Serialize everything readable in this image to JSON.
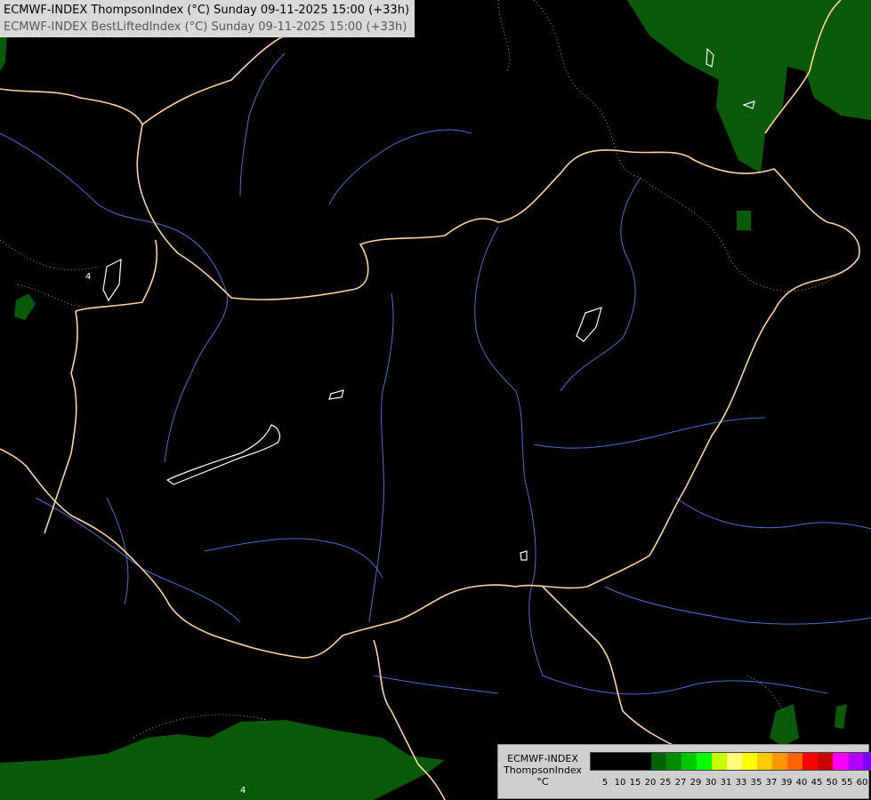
{
  "header": {
    "line1": "ECMWF-INDEX ThompsonIndex (°C) Sunday 09-11-2025 15:00 (+33h)",
    "line2": "ECMWF-INDEX BestLiftedIndex (°C) Sunday 09-11-2025 15:00 (+33h)"
  },
  "map": {
    "background": "#000000",
    "region_fill": "#0a5a0a",
    "border_color": "#ffd39b",
    "river_color": "#4a6fd1",
    "lake_color": "#ffffff",
    "contour_labels": [
      "4",
      "4"
    ]
  },
  "legend": {
    "title_lines": [
      "ECMWF-INDEX",
      "ThompsonIndex",
      "°C"
    ],
    "colors": [
      "#000000",
      "#000000",
      "#000000",
      "#000000",
      "#006400",
      "#008c00",
      "#00c800",
      "#00ff00",
      "#c8ff00",
      "#ffff7a",
      "#ffff00",
      "#ffc800",
      "#ff9600",
      "#ff6400",
      "#ff0000",
      "#c80000",
      "#ff00ff",
      "#b400ff",
      "#7d00ff",
      "#5000ff",
      "#0000ff"
    ],
    "ticks": [
      "5",
      "10",
      "15",
      "20",
      "25",
      "27",
      "29",
      "30",
      "31",
      "33",
      "35",
      "37",
      "39",
      "40",
      "45",
      "50",
      "55",
      "60"
    ]
  }
}
